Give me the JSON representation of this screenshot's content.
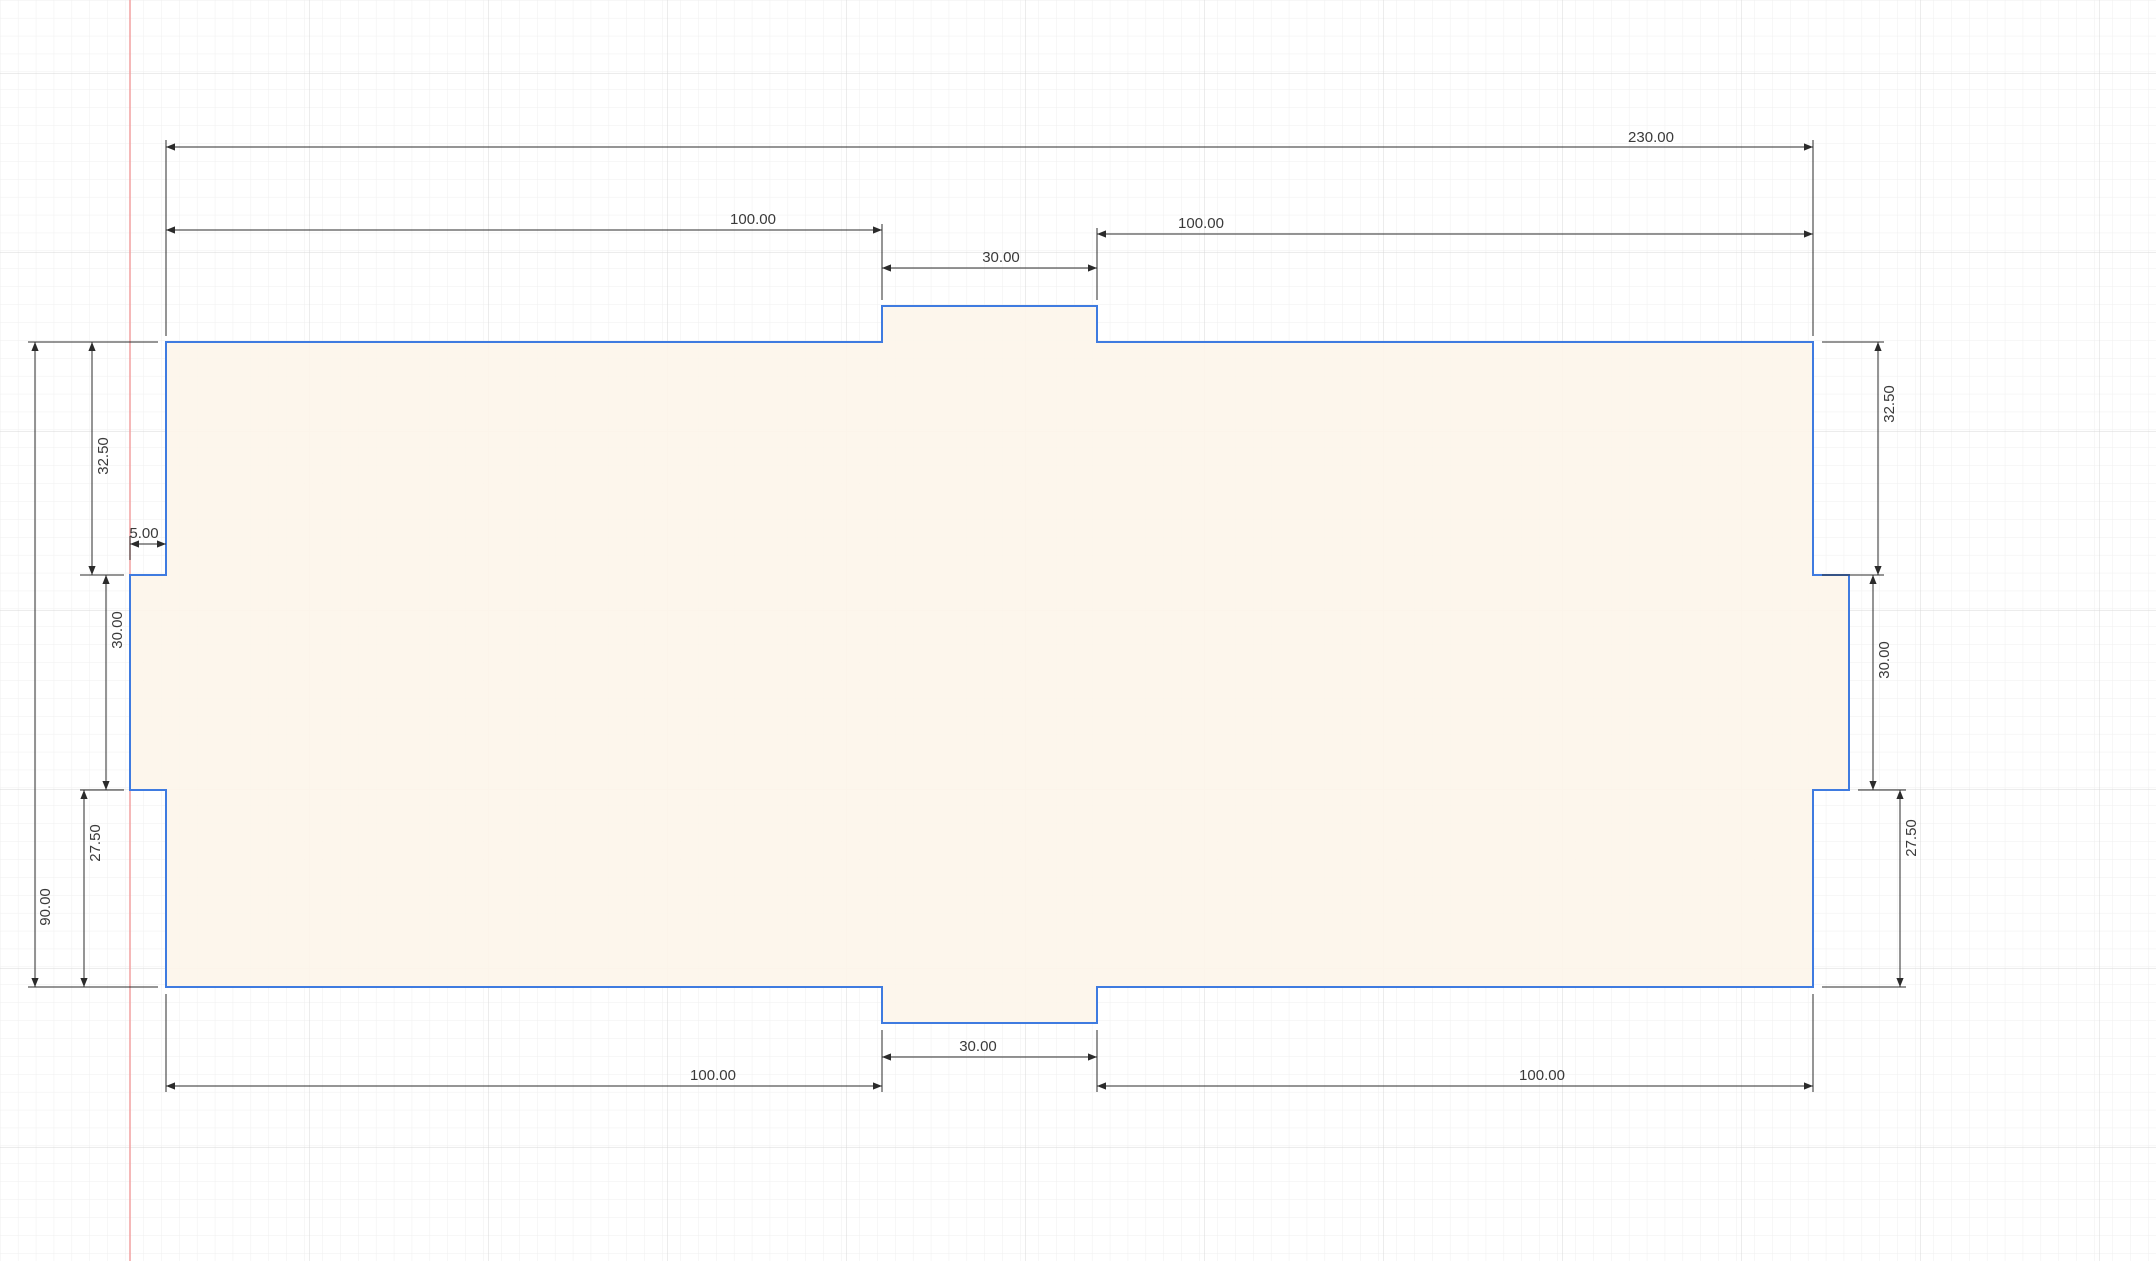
{
  "sketch": {
    "profile_fill": "#fdf5ea",
    "profile_stroke": "#3f7be0",
    "dimension_color": "#2b2b2b",
    "grid_minor_color": "#ececec",
    "grid_major_color": "#dcdcdc",
    "axis_color": "#f2a0a0"
  },
  "dimensions": {
    "overall_width": "230.00",
    "top_left_length": "100.00",
    "top_slot_width": "30.00",
    "top_right_length": "100.00",
    "bottom_left_length": "100.00",
    "bottom_slot_width": "30.00",
    "bottom_right_length": "100.00",
    "overall_height": "90.00",
    "left_upper_offset": "32.50",
    "left_notch_depth": "5.00",
    "left_tab_height": "30.00",
    "left_lower_offset": "27.50",
    "right_upper_offset": "32.50",
    "right_tab_height": "30.00",
    "right_lower_offset": "27.50"
  }
}
